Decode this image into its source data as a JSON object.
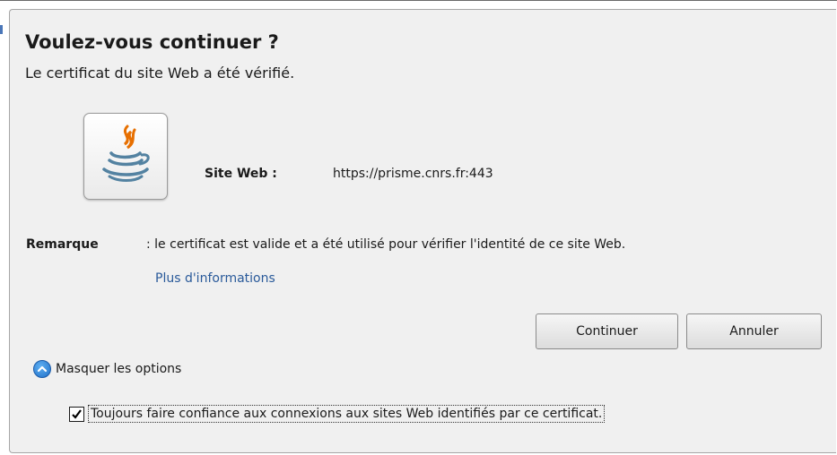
{
  "dialog": {
    "title": "Voulez-vous continuer ?",
    "subtitle": "Le certificat du site Web a été vérifié.",
    "app_icon": "java-icon",
    "site_label": "Site Web :",
    "site_value": "https://prisme.cnrs.fr:443",
    "note_label": "Remarque",
    "note_text": ": le certificat est valide et a été utilisé pour vérifier l'identité de ce site Web.",
    "more_info_link": "Plus d'informations",
    "continue_button": "Continuer",
    "cancel_button": "Annuler",
    "options_toggle": {
      "label": "Masquer les options",
      "icon": "chevron-up-circle-icon"
    },
    "trust_checkbox": {
      "label": "Toujours faire confiance aux connexions aux sites Web identifiés par ce certificat.",
      "checked": true
    }
  },
  "colors": {
    "dialog_background": "#f0f0f0",
    "link": "#2a5a9a",
    "toggle_icon": "#2a7fd4"
  }
}
